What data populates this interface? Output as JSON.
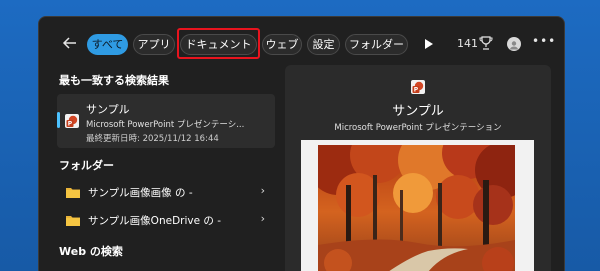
{
  "colors": {
    "desktop": "#1a65b8",
    "panel": "#202020",
    "active_pill": "#2f9be3",
    "highlight_box": "#e8141e",
    "accent": "#4cc2ff"
  },
  "header": {
    "back_icon": "arrow-left-icon",
    "filters": [
      "すべて",
      "アプリ",
      "ドキュメント",
      "ウェブ",
      "設定",
      "フォルダー"
    ],
    "active_filter": "すべて",
    "points": "141",
    "play_icon": "play-icon",
    "rewards_icon": "trophy-icon",
    "more_icon": "more-icon"
  },
  "best_match": {
    "heading": "最も一致する検索結果",
    "name": "サンプル",
    "type": "Microsoft PowerPoint プレゼンテーシ...",
    "modified": "最終更新日時: 2025/11/12 16:44",
    "icon": "powerpoint-icon"
  },
  "folders": {
    "heading": "フォルダー",
    "items": [
      {
        "label": "サンプル画像画像 の -",
        "icon": "folder-icon"
      },
      {
        "label": "サンプル画像OneDrive の -",
        "icon": "folder-icon"
      }
    ]
  },
  "web": {
    "heading": "Web の検索"
  },
  "preview": {
    "title": "サンプル",
    "subtitle": "Microsoft PowerPoint プレゼンテーション",
    "icon": "powerpoint-icon",
    "thumbnail": "autumn-forest-slide"
  }
}
